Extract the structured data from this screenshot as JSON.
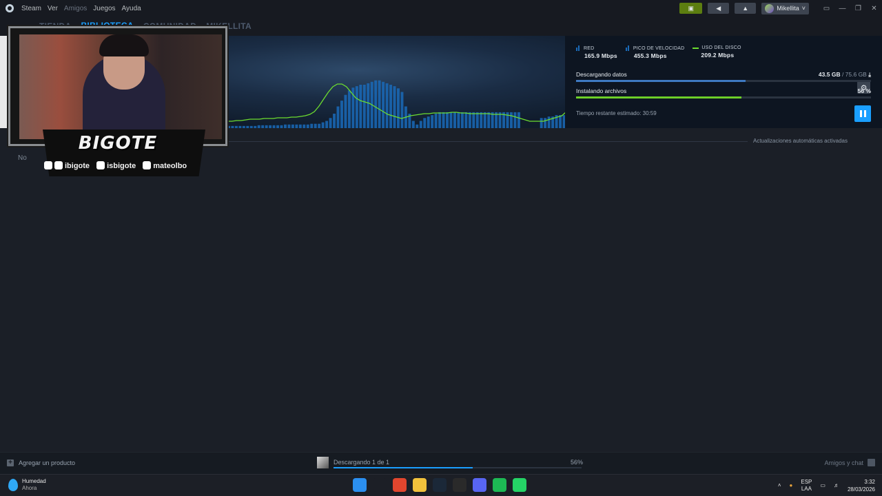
{
  "titlebar": {
    "menu": [
      "Steam",
      "Ver",
      "Amigos",
      "Juegos",
      "Ayuda"
    ],
    "username": "Mikellita"
  },
  "nav": {
    "tabs": [
      "TIENDA",
      "BIBLIOTECA",
      "COMUNIDAD",
      "MIKELLITA"
    ],
    "active_tab": "BIBLIOTECA"
  },
  "download": {
    "stats": [
      {
        "label": "RED",
        "value": "165.9 Mbps"
      },
      {
        "label": "PICO DE VELOCIDAD",
        "value": "455.3 Mbps"
      },
      {
        "label": "USO DEL DISCO",
        "value": "209.2 Mbps"
      }
    ],
    "downloading_label": "Descargando datos",
    "downloaded": "43.5 GB",
    "total": " / 75.6 GB",
    "download_progress": 0.575,
    "installing_label": "Instalando archivos",
    "install_percent": "56 %",
    "install_progress": 0.56,
    "time_remaining": "Tiempo restante estimado: 30:59",
    "network_bars": [
      3,
      3,
      3,
      3,
      3,
      3,
      3,
      3,
      4,
      4,
      4,
      4,
      4,
      4,
      4,
      5,
      5,
      5,
      5,
      5,
      5,
      5,
      6,
      6,
      6,
      8,
      10,
      14,
      20,
      30,
      38,
      46,
      52,
      56,
      58,
      60,
      60,
      62,
      64,
      66,
      66,
      64,
      62,
      60,
      58,
      55,
      50,
      30,
      20,
      10,
      5,
      10,
      14,
      16,
      18,
      20,
      22,
      22,
      22,
      22,
      22,
      22,
      22,
      22,
      22,
      22,
      22,
      22,
      22,
      22,
      22,
      22,
      22,
      22,
      22,
      22,
      22,
      22,
      0,
      0,
      0,
      0,
      0,
      14,
      14,
      16,
      16,
      18,
      18,
      18
    ],
    "disk_line": [
      10,
      10,
      11,
      11,
      12,
      13,
      13,
      13,
      14,
      14,
      14,
      15,
      15,
      15,
      16,
      16,
      17,
      18,
      20,
      24,
      32,
      42,
      52,
      60,
      64,
      64,
      60,
      52,
      44,
      40,
      38,
      36,
      32,
      28,
      24,
      20,
      18,
      16,
      14,
      16,
      18,
      19,
      20,
      21,
      21,
      22,
      22,
      22,
      22,
      23,
      23,
      22,
      22,
      21,
      21,
      21,
      21,
      21,
      20,
      20,
      20,
      19,
      18,
      16,
      14,
      12,
      10,
      10,
      10,
      10,
      12,
      14,
      16,
      18,
      24
    ],
    "accent_network": "#1a6ab8",
    "accent_disk": "#6dde2f"
  },
  "content": {
    "auto_updates": "Actualizaciones automáticas activadas",
    "partial_label": "No"
  },
  "overlay": {
    "brand": "BIGOTE",
    "socials": [
      "ibigote",
      "isbigote",
      "mateolbo"
    ]
  },
  "bottombar": {
    "add_product": "Agregar un producto",
    "downloading": "Descargando 1 de 1",
    "percent": "56%",
    "progress": 0.56,
    "friends_chat": "Amigos y chat"
  },
  "taskbar": {
    "weather_title": "Humedad",
    "weather_sub": "Ahora",
    "lang_top": "ESP",
    "lang_bottom": "LAA",
    "time": "3:32",
    "date": "28/03/2026",
    "apps": [
      {
        "name": "windows-start",
        "color": "#2b8ff0"
      },
      {
        "name": "search",
        "color": "#1c1f26"
      },
      {
        "name": "brave",
        "color": "#e2462e"
      },
      {
        "name": "file-explorer",
        "color": "#f2c23c"
      },
      {
        "name": "steam",
        "color": "#1b2838"
      },
      {
        "name": "obs",
        "color": "#2a2a2a"
      },
      {
        "name": "discord",
        "color": "#5865f2"
      },
      {
        "name": "spotify",
        "color": "#1db954"
      },
      {
        "name": "whatsapp",
        "color": "#25d366"
      }
    ]
  }
}
